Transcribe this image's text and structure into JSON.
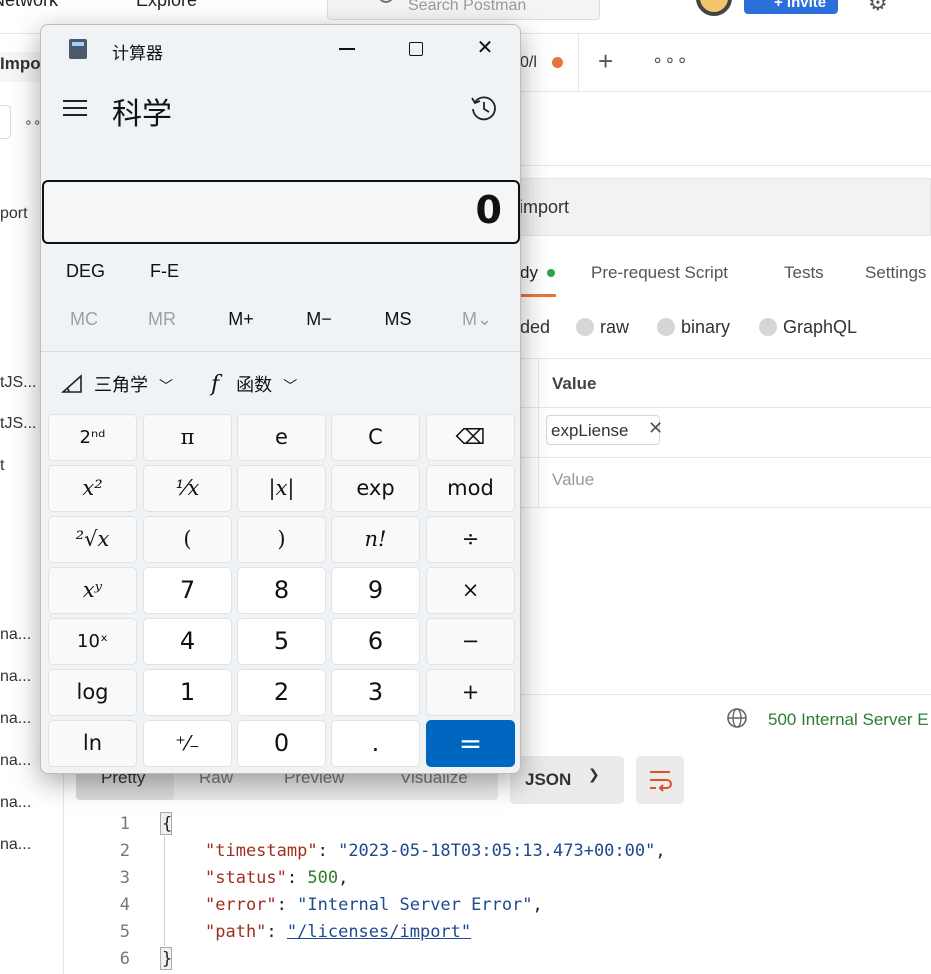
{
  "postman": {
    "topbar": {
      "nav_network": "Network",
      "nav_explore": "Explore",
      "search_placeholder": "Search Postman",
      "invite_label": "+ Invite"
    },
    "sidebar": {
      "import_label": "Import",
      "items": [
        "port",
        "tJS...",
        "tJS...",
        "t",
        "na...",
        "na...",
        "na...",
        "na...",
        "na...",
        "na..."
      ]
    },
    "tab": {
      "active_label": "0/l"
    },
    "url": {
      "value": "import"
    },
    "request_tabs": {
      "body": "dy",
      "prerequest": "Pre-request Script",
      "tests": "Tests",
      "settings": "Settings"
    },
    "body_types": {
      "urlencoded": "ded",
      "raw": "raw",
      "binary": "binary",
      "graphql": "GraphQL"
    },
    "params": {
      "value_header": "Value",
      "row1_value": "expLiense",
      "row2_placeholder": "Value"
    },
    "response": {
      "status": "500 Internal Server E",
      "views": [
        "Pretty",
        "Raw",
        "Preview",
        "Visualize"
      ],
      "format": "JSON",
      "lines": [
        {
          "no": "1",
          "text": "{"
        },
        {
          "no": "2",
          "key": "\"timestamp\"",
          "val": "\"2023-05-18T03:05:13.473+00:00\"",
          "trail": ","
        },
        {
          "no": "3",
          "key": "\"status\"",
          "val": "500",
          "trail": ","
        },
        {
          "no": "4",
          "key": "\"error\"",
          "val": "\"Internal Server Error\"",
          "trail": ","
        },
        {
          "no": "5",
          "key": "\"path\"",
          "val": "\"/licenses/import\"",
          "trail": ""
        },
        {
          "no": "6",
          "text": "}"
        }
      ]
    }
  },
  "calculator": {
    "title": "计算器",
    "mode": "科学",
    "display": "0",
    "angle_mode": "DEG",
    "fe_label": "F-E",
    "memory": [
      "MC",
      "MR",
      "M+",
      "M−",
      "MS",
      "M⌄"
    ],
    "trig_label": "三角学",
    "func_label": "函数",
    "keys": [
      [
        "2ⁿᵈ",
        "π",
        "e",
        "C",
        "⌫"
      ],
      [
        "x²",
        "¹⁄x",
        "|x|",
        "exp",
        "mod"
      ],
      [
        "²√x",
        "(",
        ")",
        "n!",
        "÷"
      ],
      [
        "xʸ",
        "7",
        "8",
        "9",
        "×"
      ],
      [
        "10ˣ",
        "4",
        "5",
        "6",
        "−"
      ],
      [
        "log",
        "1",
        "2",
        "3",
        "+"
      ],
      [
        "ln",
        "⁺⁄₋",
        "0",
        ".",
        "="
      ]
    ]
  },
  "colors": {
    "accent": "#0067c0",
    "postman_orange": "#e8743b",
    "status_green": "#2f7d32"
  }
}
